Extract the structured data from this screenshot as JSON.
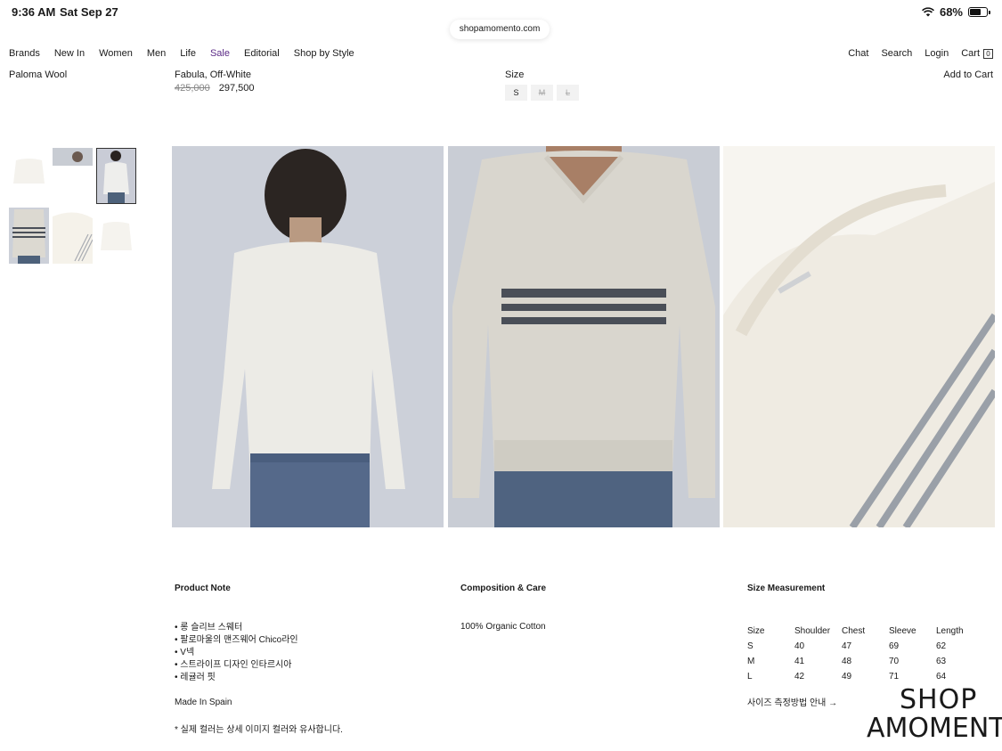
{
  "status": {
    "time": "9:36 AM",
    "date": "Sat Sep 27",
    "battery": "68%",
    "battery_level": 0.68
  },
  "url": "shopamomento.com",
  "nav": {
    "items": [
      "Brands",
      "New In",
      "Women",
      "Men",
      "Life",
      "Sale",
      "Editorial",
      "Shop by Style"
    ],
    "right": {
      "chat": "Chat",
      "search": "Search",
      "login": "Login",
      "cart": "Cart",
      "cart_count": "0"
    },
    "sale_color": "#5b2a86"
  },
  "product": {
    "brand": "Paloma Wool",
    "name": "Fabula, Off-White",
    "old_price": "425,000",
    "price": "297,500",
    "size_label": "Size",
    "sizes": [
      "S",
      "M",
      "L"
    ],
    "add_to_cart": "Add to Cart"
  },
  "sections": {
    "note_title": "Product Note",
    "note_items": [
      "• 롱 슬리브 스웨터",
      "• 팔로마울의 맨즈웨어 Chico라인",
      "• V넥",
      "• 스트라이프 디자인 인타르시아",
      "• 레귤러 핏"
    ],
    "made_in": "Made In Spain",
    "disclaimer": "* 실제 컬러는 상세 이미지 컬러와 유사합니다.",
    "comp_title": "Composition & Care",
    "composition": "100% Organic Cotton",
    "size_title": "Size Measurement",
    "size_headers": [
      "Size",
      "Shoulder",
      "Chest",
      "Sleeve",
      "Length"
    ],
    "size_rows": [
      [
        "S",
        "40",
        "47",
        "69",
        "62"
      ],
      [
        "M",
        "41",
        "48",
        "70",
        "63"
      ],
      [
        "L",
        "42",
        "49",
        "71",
        "64"
      ]
    ],
    "size_guide": "사이즈 측정방법 안내 →"
  },
  "logo": {
    "line1": "SHOP",
    "line2": "AMOMENTO,"
  }
}
